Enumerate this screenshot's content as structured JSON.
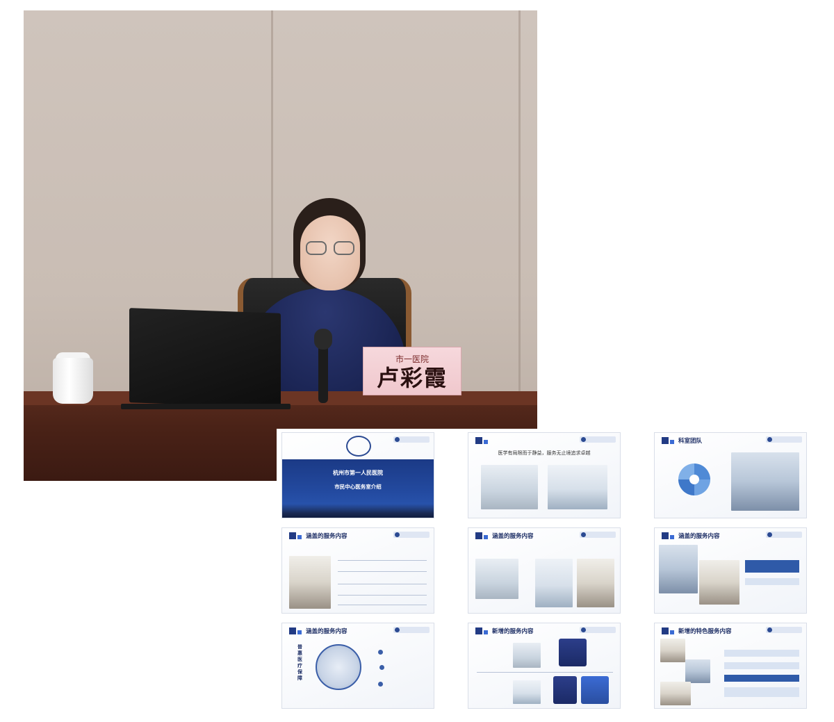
{
  "photo": {
    "nameplate": {
      "org": "市一医院",
      "name": "卢彩霞"
    }
  },
  "slides": [
    {
      "id": 1,
      "type": "cover",
      "title_line1": "杭州市第一人民医院",
      "title_line2": "市民中心医务室介绍"
    },
    {
      "id": 2,
      "header_text": "医学有局限而于静益，服务无止境追求卓越"
    },
    {
      "id": 3,
      "title": "科室团队"
    },
    {
      "id": 4,
      "title": "涵盖的服务内容"
    },
    {
      "id": 5,
      "title": "涵盖的服务内容"
    },
    {
      "id": 6,
      "title": "涵盖的服务内容"
    },
    {
      "id": 7,
      "title": "涵盖的服务内容",
      "vertical_text": "普惠医疗保障"
    },
    {
      "id": 8,
      "title": "新增的服务内容"
    },
    {
      "id": 9,
      "title": "新增的特色服务内容"
    }
  ],
  "colors": {
    "slide_blue": "#223b84",
    "nameplate_pink": "#f0c8cd",
    "desk_brown": "#4a2217"
  }
}
